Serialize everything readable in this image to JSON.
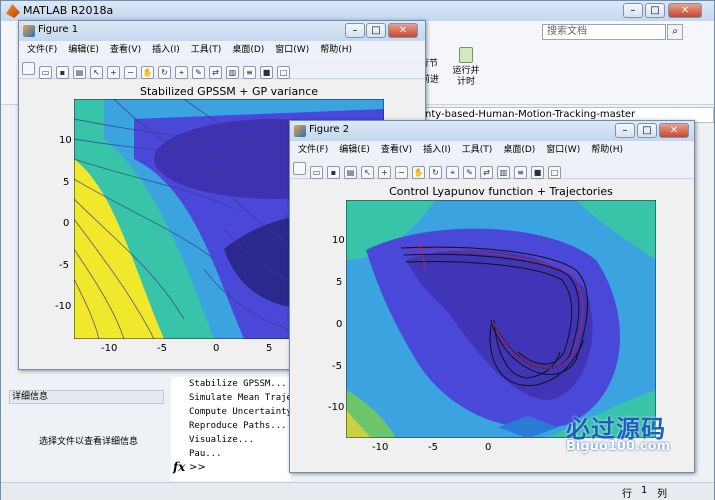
{
  "matlab": {
    "title": "MATLAB R2018a",
    "search_placeholder": "搜索文档",
    "run_section_label": "运行节",
    "advance_label": "前进",
    "run_time_label": "运行并计时",
    "path_text": "nty-based-Human-Motion-Tracking-master",
    "detail_header": "详细信息",
    "detail_text": "选择文件以查看详细信息",
    "command_lines": [
      "Stabilize GPSSM...",
      "Simulate Mean Trajec",
      "Compute Uncertainty",
      "Reproduce Paths...",
      "Visualize...",
      "Pau..."
    ],
    "fx_label": "fx",
    "prompt": ">>",
    "status_row": "行",
    "status_col": "1",
    "status_col_label": "列"
  },
  "menu": [
    "文件(F)",
    "编辑(E)",
    "查看(V)",
    "插入(I)",
    "工具(T)",
    "桌面(D)",
    "窗口(W)",
    "帮助(H)"
  ],
  "figure1": {
    "title": "Figure 1",
    "plot_title": "Stabilized GPSSM + GP variance",
    "yticks": [
      "10",
      "5",
      "0",
      "-5",
      "-10"
    ],
    "xticks": [
      "-10",
      "-5",
      "0",
      "5"
    ]
  },
  "figure2": {
    "title": "Figure 2",
    "plot_title": "Control Lyapunov function + Trajectories",
    "yticks": [
      "10",
      "5",
      "0",
      "-5",
      "-10"
    ],
    "xticks": [
      "-10",
      "-5",
      "0"
    ]
  },
  "watermark": {
    "line1": "必过源码",
    "line2": "Biguo100.com"
  }
}
